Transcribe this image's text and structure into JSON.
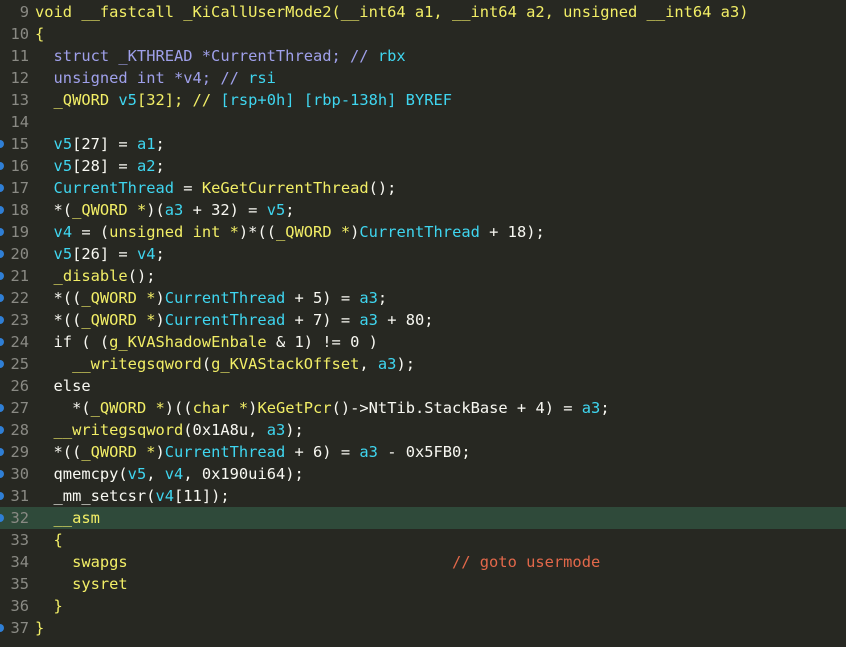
{
  "lines": [
    {
      "n": "9",
      "dot": false,
      "hl": false,
      "tokens": [
        [
          "void __fastcall _KiCallUserMode2(__int64 a1, __int64 a2, unsigned __int64 a3)",
          "k"
        ]
      ]
    },
    {
      "n": "10",
      "dot": false,
      "hl": false,
      "tokens": [
        [
          "{",
          "y"
        ]
      ]
    },
    {
      "n": "11",
      "dot": false,
      "hl": false,
      "tokens": [
        [
          "  struct _KTHREAD *CurrentThread; // ",
          "i"
        ],
        [
          "rbx",
          "v"
        ]
      ]
    },
    {
      "n": "12",
      "dot": false,
      "hl": false,
      "tokens": [
        [
          "  unsigned int *v4; // ",
          "i"
        ],
        [
          "rsi",
          "v"
        ]
      ]
    },
    {
      "n": "13",
      "dot": false,
      "hl": false,
      "tokens": [
        [
          "  _QWORD ",
          "y"
        ],
        [
          "v5",
          "v"
        ],
        [
          "[32]; // ",
          "y"
        ],
        [
          "[rsp+0h] [rbp-138h] BYREF",
          "v"
        ]
      ]
    },
    {
      "n": "14",
      "dot": false,
      "hl": false,
      "tokens": []
    },
    {
      "n": "15",
      "dot": true,
      "hl": false,
      "tokens": [
        [
          "  ",
          "p"
        ],
        [
          "v5",
          "v"
        ],
        [
          "[27] = ",
          "p"
        ],
        [
          "a1",
          "v"
        ],
        [
          ";",
          "p"
        ]
      ]
    },
    {
      "n": "16",
      "dot": true,
      "hl": false,
      "tokens": [
        [
          "  ",
          "p"
        ],
        [
          "v5",
          "v"
        ],
        [
          "[28] = ",
          "p"
        ],
        [
          "a2",
          "v"
        ],
        [
          ";",
          "p"
        ]
      ]
    },
    {
      "n": "17",
      "dot": true,
      "hl": false,
      "tokens": [
        [
          "  ",
          "p"
        ],
        [
          "CurrentThread",
          "v"
        ],
        [
          " = ",
          "p"
        ],
        [
          "KeGetCurrentThread",
          "y"
        ],
        [
          "();",
          "p"
        ]
      ]
    },
    {
      "n": "18",
      "dot": true,
      "hl": false,
      "tokens": [
        [
          "  *(",
          "p"
        ],
        [
          "_QWORD *",
          "y"
        ],
        [
          ")(",
          "p"
        ],
        [
          "a3",
          "v"
        ],
        [
          " + 32) = ",
          "p"
        ],
        [
          "v5",
          "v"
        ],
        [
          ";",
          "p"
        ]
      ]
    },
    {
      "n": "19",
      "dot": true,
      "hl": false,
      "tokens": [
        [
          "  ",
          "p"
        ],
        [
          "v4",
          "v"
        ],
        [
          " = (",
          "p"
        ],
        [
          "unsigned int *",
          "y"
        ],
        [
          ")*((",
          "p"
        ],
        [
          "_QWORD *",
          "y"
        ],
        [
          ")",
          "p"
        ],
        [
          "CurrentThread",
          "v"
        ],
        [
          " + 18);",
          "p"
        ]
      ]
    },
    {
      "n": "20",
      "dot": true,
      "hl": false,
      "tokens": [
        [
          "  ",
          "p"
        ],
        [
          "v5",
          "v"
        ],
        [
          "[26] = ",
          "p"
        ],
        [
          "v4",
          "v"
        ],
        [
          ";",
          "p"
        ]
      ]
    },
    {
      "n": "21",
      "dot": true,
      "hl": false,
      "tokens": [
        [
          "  ",
          "p"
        ],
        [
          "_disable",
          "y"
        ],
        [
          "();",
          "p"
        ]
      ]
    },
    {
      "n": "22",
      "dot": true,
      "hl": false,
      "tokens": [
        [
          "  *((",
          "p"
        ],
        [
          "_QWORD *",
          "y"
        ],
        [
          ")",
          "p"
        ],
        [
          "CurrentThread",
          "v"
        ],
        [
          " + 5) = ",
          "p"
        ],
        [
          "a3",
          "v"
        ],
        [
          ";",
          "p"
        ]
      ]
    },
    {
      "n": "23",
      "dot": true,
      "hl": false,
      "tokens": [
        [
          "  *((",
          "p"
        ],
        [
          "_QWORD *",
          "y"
        ],
        [
          ")",
          "p"
        ],
        [
          "CurrentThread",
          "v"
        ],
        [
          " + 7) = ",
          "p"
        ],
        [
          "a3",
          "v"
        ],
        [
          " + 80;",
          "p"
        ]
      ]
    },
    {
      "n": "24",
      "dot": true,
      "hl": false,
      "tokens": [
        [
          "  if ( (",
          "p"
        ],
        [
          "g_KVAShadowEnbale",
          "y"
        ],
        [
          " & 1) != 0 )",
          "p"
        ]
      ]
    },
    {
      "n": "25",
      "dot": true,
      "hl": false,
      "tokens": [
        [
          "    ",
          "p"
        ],
        [
          "__writegsqword",
          "y"
        ],
        [
          "(",
          "p"
        ],
        [
          "g_KVAStackOffset",
          "y"
        ],
        [
          ", ",
          "p"
        ],
        [
          "a3",
          "v"
        ],
        [
          ");",
          "p"
        ]
      ]
    },
    {
      "n": "26",
      "dot": false,
      "hl": false,
      "tokens": [
        [
          "  else",
          "p"
        ]
      ]
    },
    {
      "n": "27",
      "dot": true,
      "hl": false,
      "tokens": [
        [
          "    *(",
          "p"
        ],
        [
          "_QWORD *",
          "y"
        ],
        [
          ")((",
          "p"
        ],
        [
          "char *",
          "y"
        ],
        [
          ")",
          "p"
        ],
        [
          "KeGetPcr",
          "y"
        ],
        [
          "()->NtTib.StackBase + 4) = ",
          "p"
        ],
        [
          "a3",
          "v"
        ],
        [
          ";",
          "p"
        ]
      ]
    },
    {
      "n": "28",
      "dot": true,
      "hl": false,
      "tokens": [
        [
          "  ",
          "p"
        ],
        [
          "__writegsqword",
          "y"
        ],
        [
          "(0x1A8u, ",
          "p"
        ],
        [
          "a3",
          "v"
        ],
        [
          ");",
          "p"
        ]
      ]
    },
    {
      "n": "29",
      "dot": true,
      "hl": false,
      "tokens": [
        [
          "  *((",
          "p"
        ],
        [
          "_QWORD *",
          "y"
        ],
        [
          ")",
          "p"
        ],
        [
          "CurrentThread",
          "v"
        ],
        [
          " + 6) = ",
          "p"
        ],
        [
          "a3",
          "v"
        ],
        [
          " - 0x5FB0;",
          "p"
        ]
      ]
    },
    {
      "n": "30",
      "dot": true,
      "hl": false,
      "tokens": [
        [
          "  qmemcpy(",
          "p"
        ],
        [
          "v5",
          "v"
        ],
        [
          ", ",
          "p"
        ],
        [
          "v4",
          "v"
        ],
        [
          ", 0x190ui64);",
          "p"
        ]
      ]
    },
    {
      "n": "31",
      "dot": true,
      "hl": false,
      "tokens": [
        [
          "  _mm_setcsr(",
          "p"
        ],
        [
          "v4",
          "v"
        ],
        [
          "[11]);",
          "p"
        ]
      ]
    },
    {
      "n": "32",
      "dot": true,
      "hl": true,
      "tokens": [
        [
          "  __asm",
          "y"
        ]
      ]
    },
    {
      "n": "33",
      "dot": false,
      "hl": false,
      "tokens": [
        [
          "  {",
          "y"
        ]
      ]
    },
    {
      "n": "34",
      "dot": false,
      "hl": false,
      "tokens": [
        [
          "    swapgs                                   ",
          "y"
        ],
        [
          "// goto usermode",
          "c"
        ]
      ]
    },
    {
      "n": "35",
      "dot": false,
      "hl": false,
      "tokens": [
        [
          "    sysret",
          "y"
        ]
      ]
    },
    {
      "n": "36",
      "dot": false,
      "hl": false,
      "tokens": [
        [
          "  }",
          "y"
        ]
      ]
    },
    {
      "n": "37",
      "dot": true,
      "hl": false,
      "tokens": [
        [
          "}",
          "y"
        ]
      ]
    }
  ],
  "colors": {
    "background": "#272822",
    "line_number": "#8a8a84",
    "keyword_yellow": "#f2ee66",
    "variable_cyan": "#3fd6f0",
    "comment_purple": "#9fa0ea",
    "comment_red": "#e3684a",
    "highlight_line": "#2f4a3a",
    "breakpoint_dot": "#2f7fd6"
  }
}
